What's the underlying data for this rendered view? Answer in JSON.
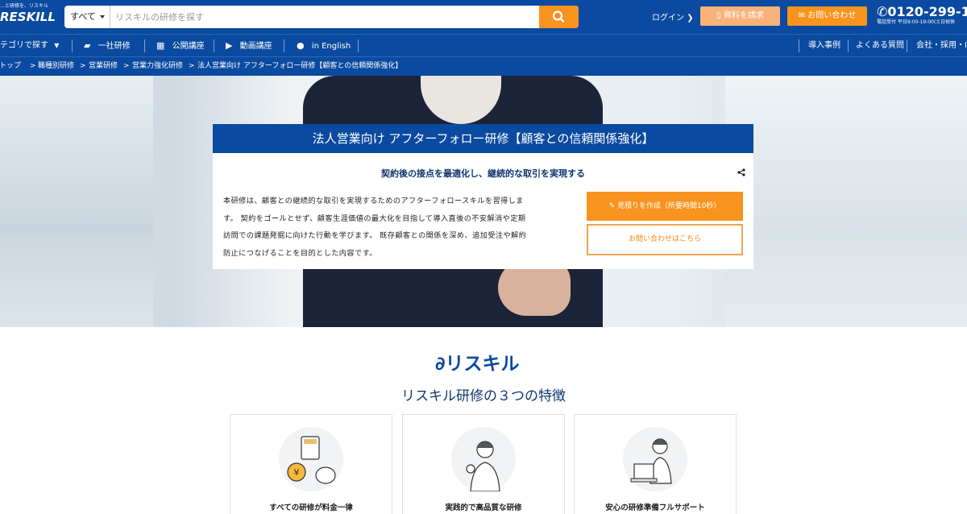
{
  "header": {
    "logo_tagline": "…と研修を、リスキル",
    "logo_name": "RESKILL",
    "search_scope": "すべて",
    "search_placeholder": "リスキルの研修を探す",
    "login": "ログイン",
    "doc_request": "資料を請求",
    "contact": "お問い合わせ",
    "phone": "0120-299-1",
    "hours": "電話受付 平日9:00-19:00(土日祝休"
  },
  "nav": {
    "category": "テゴリで探す",
    "items": [
      "一社研修",
      "公開講座",
      "動画講座",
      "in English"
    ],
    "right_items": [
      "導入事例",
      "よくある質問",
      "会社・採用・IR"
    ]
  },
  "breadcrumb": [
    "トップ",
    "職種別研修",
    "営業研修",
    "営業力強化研修",
    "法人営業向け アフターフォロー研修【顧客との信頼関係強化】"
  ],
  "hero": {
    "title": "法人営業向け アフターフォロー研修【顧客との信頼関係強化】",
    "subtitle": "契約後の接点を最適化し、継続的な取引を実現する",
    "description": [
      "本研修は、顧客との継続的な取引を実現するためのアフターフォロースキルを習得しま",
      "す。 契約をゴールとせず、顧客生涯価値の最大化を目指して導入直後の不安解消や定期",
      "訪問での課題発掘に向けた行動を学びます。 既存顧客との関係を深め、追加受注や解約",
      "防止につなげることを目的とした内容です。"
    ],
    "estimate_button": "見積りを作成（所要時間10秒）",
    "inquiry_button": "お問い合わせはこちら"
  },
  "features": {
    "brand": "リスキル",
    "title": "リスキル研修の３つの特徴",
    "items": [
      {
        "label": "すべての研修が料金一律",
        "icon": "calculator-coin-icon"
      },
      {
        "label": "実践的で高品質な研修",
        "icon": "ok-sign-person-icon"
      },
      {
        "label": "安心の研修準備フルサポート",
        "icon": "support-operator-icon"
      }
    ]
  },
  "colors": {
    "primary": "#0a4aa0",
    "accent": "#f7931e"
  }
}
